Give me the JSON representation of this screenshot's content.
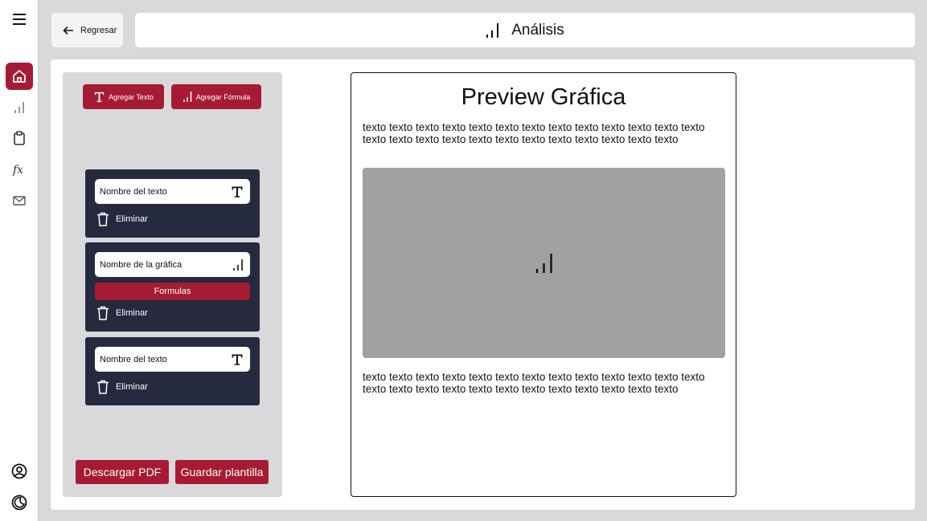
{
  "nav": {
    "items": [
      "menu",
      "home",
      "analytics",
      "clipboard",
      "formula",
      "mail",
      "profile",
      "theme"
    ]
  },
  "header": {
    "back_label": "Regresar",
    "title": "Análisis"
  },
  "editor": {
    "add_text_label": "Agregar Texto",
    "add_formula_label": "Agregar Fórmula",
    "cards": [
      {
        "type": "text",
        "name": "Nombre del texto",
        "delete_label": "Eliminar"
      },
      {
        "type": "chart",
        "name": "Nombre de la gráfica",
        "formulas_label": "Formulas",
        "delete_label": "Eliminar"
      },
      {
        "type": "text",
        "name": "Nombre del texto",
        "delete_label": "Eliminar"
      }
    ],
    "download_pdf_label": "Descargar PDF",
    "save_template_label": "Guardar plantilla"
  },
  "preview": {
    "title": "Preview Gráfica",
    "text_top": "texto texto texto texto texto texto texto texto texto texto texto texto texto texto texto texto texto texto texto texto texto texto texto texto texto",
    "text_bottom": "texto texto texto texto texto texto texto texto texto texto texto texto texto texto texto texto texto texto texto texto texto texto texto texto texto"
  },
  "colors": {
    "accent": "#a61b33",
    "card_bg": "#252a3e",
    "panel_bg": "#d9d9dc",
    "chart_placeholder": "#a1a1a1"
  }
}
